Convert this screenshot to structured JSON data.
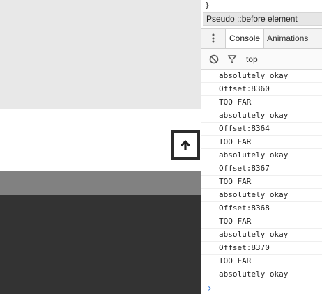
{
  "devtools": {
    "styles_snippet": "}",
    "pseudo_header": "Pseudo ::before element",
    "tabs": [
      {
        "label": "Console",
        "active": true
      },
      {
        "label": "Animations",
        "active": false
      }
    ],
    "toolbar": {
      "context": "top"
    },
    "console_lines": [
      "absolutely okay",
      "Offset:8360",
      "TOO FAR",
      "absolutely okay",
      "Offset:8364",
      "TOO FAR",
      "absolutely okay",
      "Offset:8367",
      "TOO FAR",
      "absolutely okay",
      "Offset:8368",
      "TOO FAR",
      "absolutely okay",
      "Offset:8370",
      "TOO FAR",
      "absolutely okay"
    ],
    "prompt_symbol": "›"
  },
  "page": {
    "scroll_button_icon": "arrow-up-icon"
  },
  "colors": {
    "band_top": "#e8e8e8",
    "band_grey": "#818181",
    "band_dark": "#333333",
    "prompt": "#2d74da"
  }
}
